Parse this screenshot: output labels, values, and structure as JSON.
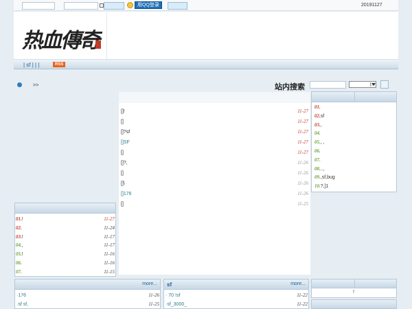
{
  "topbar": {
    "qq_login_label": "用QQ登录",
    "date_code": "20191127"
  },
  "header": {
    "logo_text": "热血傳奇"
  },
  "nav": {
    "path": "| sf |  |   |",
    "rss": "RSS"
  },
  "breadcrumb": {
    "arrow": ">>"
  },
  "search": {
    "title": "站内搜索"
  },
  "main_list": [
    {
      "title": "[]!",
      "date": "11-27",
      "style": "red"
    },
    {
      "title": "[]",
      "date": "11-27",
      "style": "red"
    },
    {
      "title": "[]?sf",
      "date": "11-27",
      "style": "red"
    },
    {
      "title": "[]SF",
      "date": "11-27",
      "style": "red"
    },
    {
      "title": "[]",
      "date": "11-27",
      "style": "red"
    },
    {
      "title": "[]?,",
      "date": "11-26",
      "style": "gray"
    },
    {
      "title": "[]",
      "date": "11-26",
      "style": "gray"
    },
    {
      "title": "[]\\",
      "date": "11-26",
      "style": "gray"
    },
    {
      "title": "[]176",
      "date": "11-26",
      "style": "gray"
    },
    {
      "title": "[]",
      "date": "11-25",
      "style": "gray"
    }
  ],
  "right_rank": [
    {
      "rank": "01.",
      "text": "",
      "color": "red"
    },
    {
      "rank": "02.",
      "text": "sf",
      "color": "red"
    },
    {
      "rank": "03.",
      "text": ",",
      "color": "red"
    },
    {
      "rank": "04.",
      "text": "",
      "color": "green"
    },
    {
      "rank": "05.",
      "text": ", ,",
      "color": "green"
    },
    {
      "rank": "06.",
      "text": "",
      "color": "green"
    },
    {
      "rank": "07.",
      "text": "",
      "color": "green"
    },
    {
      "rank": "08.",
      "text": "..,",
      "color": "green"
    },
    {
      "rank": "09.",
      "text": ",sf,bug",
      "color": "green"
    },
    {
      "rank": "10.",
      "text": "?,]1",
      "color": "green"
    }
  ],
  "left_rank": [
    {
      "rank": "01.",
      "text": "!",
      "date": "11-27",
      "color": "red",
      "datestyle": "red"
    },
    {
      "rank": "02.",
      "text": "",
      "date": "11-24",
      "color": "red",
      "datestyle": "dark"
    },
    {
      "rank": "03.",
      "text": "!",
      "date": "11-17",
      "color": "red",
      "datestyle": "dark"
    },
    {
      "rank": "04.",
      "text": ",",
      "date": "11-17",
      "color": "green",
      "datestyle": "dark"
    },
    {
      "rank": "05.",
      "text": "!",
      "date": "11-16",
      "color": "green",
      "datestyle": "dark"
    },
    {
      "rank": "06.",
      "text": "",
      "date": "11-16",
      "color": "green",
      "datestyle": "dark"
    },
    {
      "rank": "07.",
      "text": "",
      "date": "11-15",
      "color": "green",
      "datestyle": "dark"
    }
  ],
  "bottom_left": {
    "more": "more...",
    "items": [
      {
        "text": "·176",
        "date": "11-26"
      },
      {
        "text": "·sf sf,",
        "date": "11-25"
      }
    ]
  },
  "bottom_mid": {
    "title": "sf",
    "more": "more...",
    "items": [
      {
        "text": "· 70 !sf",
        "date": "11-22"
      },
      {
        "text": "·sf_3000_",
        "date": "11-22"
      }
    ]
  },
  "bottom_right": {
    "text": "!"
  }
}
